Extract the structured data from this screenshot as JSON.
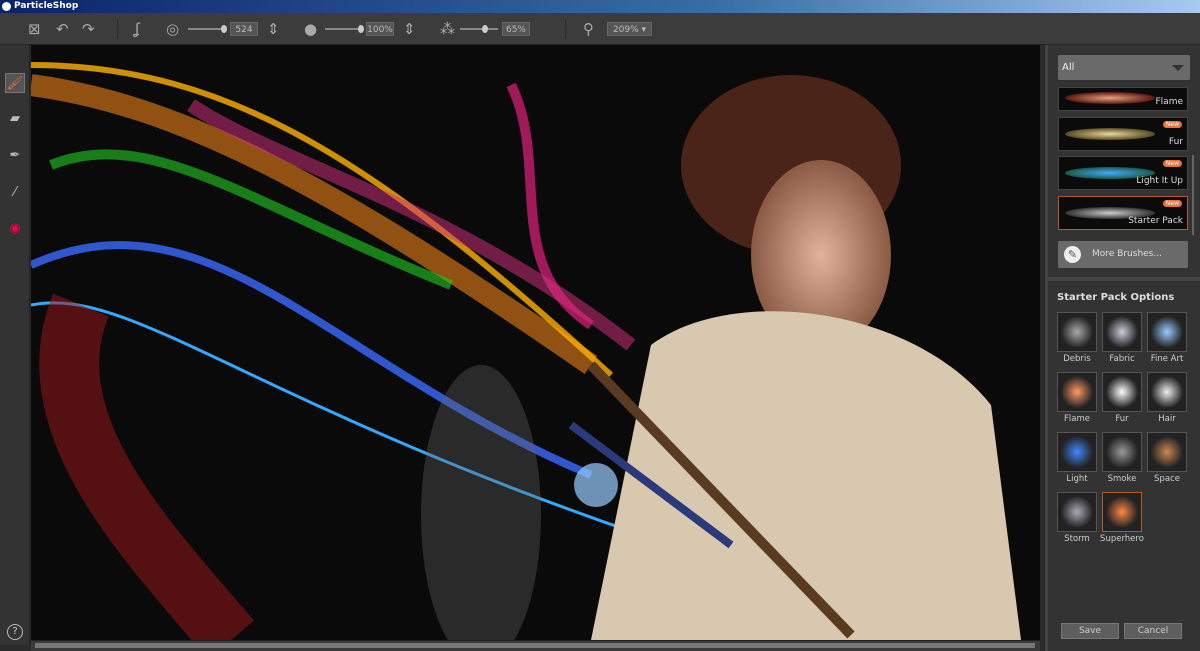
{
  "app": {
    "title": "ParticleShop"
  },
  "toolbar": {
    "brush_size": "524",
    "opacity": "100%",
    "density": "65%",
    "zoom": "209%",
    "brush_size_level": 0.85,
    "opacity_level": 1.0,
    "density_level": 0.65
  },
  "panel": {
    "category": "All",
    "brushes": [
      {
        "label": "Flame",
        "new": false
      },
      {
        "label": "Fur",
        "new": true,
        "badge": "New"
      },
      {
        "label": "Light It Up",
        "new": true,
        "badge": "New"
      },
      {
        "label": "Starter Pack",
        "new": true,
        "badge": "New",
        "selected": true
      }
    ],
    "more_brushes": "More Brushes...",
    "options_title": "Starter Pack Options",
    "presets": [
      "Debris",
      "Fabric",
      "Fine Art",
      "Flame",
      "Fur",
      "Hair",
      "Light",
      "Smoke",
      "Space",
      "Storm",
      "Superhero"
    ],
    "save": "Save",
    "cancel": "Cancel"
  },
  "help": "?"
}
